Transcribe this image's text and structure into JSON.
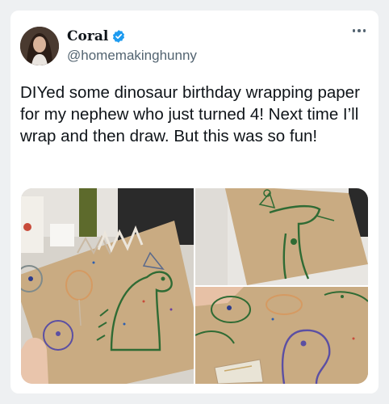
{
  "tweet": {
    "author": {
      "display_name": "Coral",
      "handle": "@homemakinghunny",
      "verified": true,
      "avatar_icon": "profile-photo"
    },
    "text": "DIYed some dinosaur birthday wrapping paper for my nephew who just turned 4! Next time I’ll wrap and then draw. But this was so fun!",
    "more_icon": "ellipsis-icon",
    "media_count": 3
  },
  "colors": {
    "text_primary": "#0f1419",
    "text_secondary": "#536471",
    "verified_blue": "#1d9bf0",
    "kraft_paper": "#c9ab82",
    "dino_green": "#2f6b34"
  }
}
